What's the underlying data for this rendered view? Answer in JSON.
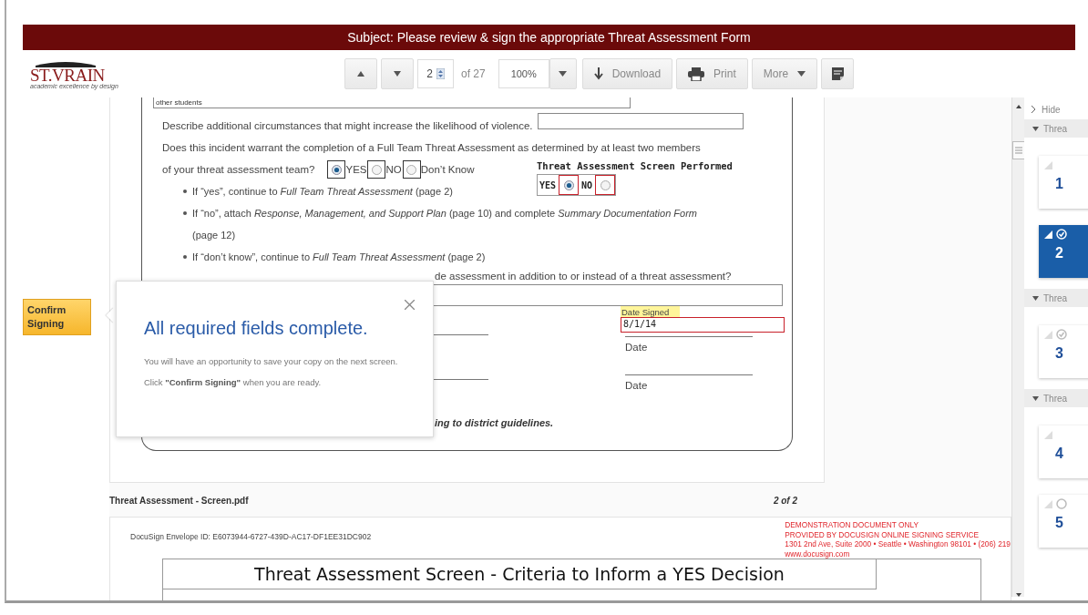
{
  "header": {
    "subject": "Subject: Please review & sign the appropriate Threat Assessment Form"
  },
  "logo": {
    "name": "ST.VRAIN",
    "tagline": "academic excellence by design"
  },
  "toolbar": {
    "page": "2",
    "page_total": "of 27",
    "zoom": "100%",
    "buttons": [
      {
        "kind": "download",
        "label": "Download"
      },
      {
        "kind": "print",
        "label": "Print"
      },
      {
        "kind": "more",
        "label": "More"
      },
      {
        "kind": "notes"
      }
    ]
  },
  "confirm_button": {
    "label": "Confirm Signing"
  },
  "form": {
    "top_field": "other students",
    "circumstances": "Describe additional circumstances that might increase the likelihood of violence.",
    "question": "Does this incident warrant the completion of a Full Team Threat Assessment as determined by at least two members",
    "question_end": "of your threat assessment team?",
    "team_radios": [
      {
        "label": "YES",
        "selected": true
      },
      {
        "label": "NO",
        "selected": false
      },
      {
        "label": "Don’t Know",
        "selected": false
      }
    ],
    "screen_performed": {
      "label": "Threat Assessment Screen Performed",
      "options": [
        {
          "label": "YES",
          "selected": true
        },
        {
          "label": "NO",
          "selected": false
        }
      ]
    },
    "bullets": [
      "If “yes”, continue to *Full Team Threat Assessment* (page 2)",
      "If “no”, attach *Response, Management, and Support Plan* (page 10) and complete *Summary Documentation Form* (page 12)",
      "If “don’t know”, continue to *Full Team Threat Assessment* (page 2)"
    ],
    "suicide_question": "de assessment in addition to or instead of a threat assessment?",
    "date_signed": {
      "label": "Date Signed",
      "value": "8/1/14"
    },
    "date_labels": [
      "Date",
      "Date"
    ],
    "guidelines": "ing to district guidelines."
  },
  "popup": {
    "title": "All required fields complete.",
    "message": "You will have an opportunity to save your copy on the next screen.",
    "instruction": "Click **\"Confirm Signing\"** when you are ready."
  },
  "file": {
    "name": "Threat Assessment - Screen.pdf",
    "pages": "2 of 2"
  },
  "page2": {
    "envelope_id": "DocuSign Envelope ID: E6073944-6727-439D-AC17-DF1EE31DC902",
    "notice": [
      "DEMONSTRATION DOCUMENT ONLY",
      "PROVIDED BY DOCUSIGN ONLINE SIGNING SERVICE",
      "1301 2nd Ave, Suite 2000 • Seattle • Washington 98101 • (206) 219",
      "www.docusign.com"
    ],
    "table_title": "Threat Assessment Screen - Criteria to Inform a YES Decision"
  },
  "sidebar": {
    "hide": "Hide",
    "items": [
      {
        "kind": "group",
        "label": "Threa"
      },
      {
        "kind": "page",
        "number": "1",
        "selected": false,
        "circle": false,
        "checked": false
      },
      {
        "kind": "page",
        "number": "2",
        "selected": true,
        "circle": true,
        "checked": true
      },
      {
        "kind": "group",
        "label": "Threa"
      },
      {
        "kind": "page",
        "number": "3",
        "selected": false,
        "circle": true,
        "checked": true
      },
      {
        "kind": "group",
        "label": "Threa"
      },
      {
        "kind": "page",
        "number": "4",
        "selected": false,
        "circle": false,
        "checked": false
      },
      {
        "kind": "page",
        "number": "5",
        "selected": false,
        "circle": true,
        "checked": false
      }
    ]
  }
}
